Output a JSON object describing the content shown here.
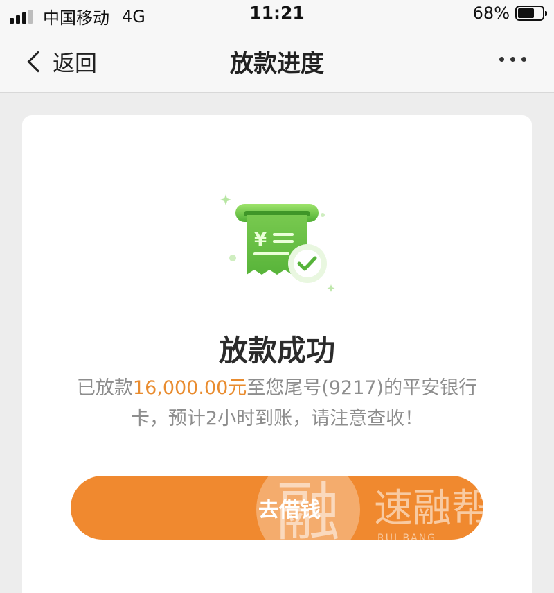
{
  "status_bar": {
    "carrier": "中国移动",
    "network": "4G",
    "time": "11:21",
    "battery_percent": "68%",
    "battery_level": 0.68
  },
  "nav": {
    "back_label": "返回",
    "title": "放款进度"
  },
  "result": {
    "title": "放款成功",
    "desc_prefix": "已放款",
    "amount": "16,000.00元",
    "desc_suffix": "至您尾号(9217)的平安银行卡，预计2小时到账，请注意查收！"
  },
  "actions": {
    "primary_label": "去借钱"
  },
  "watermark": {
    "text": "速融帮",
    "circle_char": "融",
    "latin": "RUI BANG"
  },
  "colors": {
    "accent": "#f0892f",
    "amount": "#e98c2f",
    "success_green": "#6fc54a"
  }
}
